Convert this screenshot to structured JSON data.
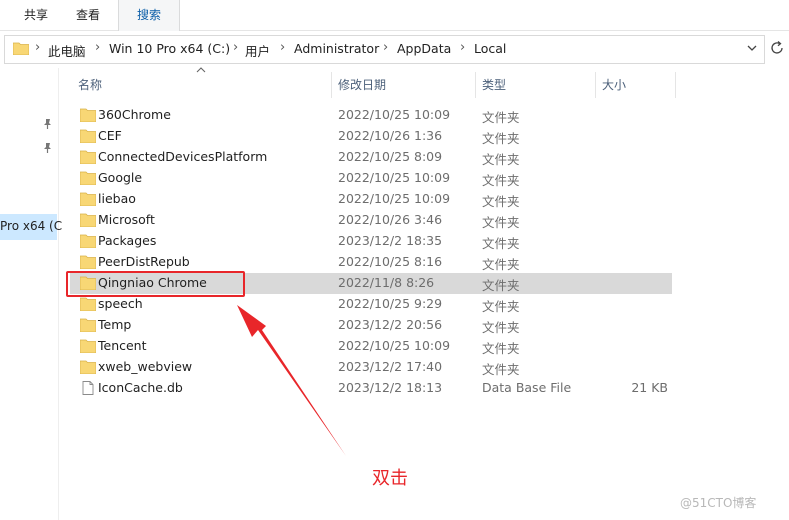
{
  "ribbon": {
    "tabs": [
      {
        "label": "共享"
      },
      {
        "label": "查看"
      },
      {
        "label": "搜索"
      }
    ]
  },
  "address": {
    "crumbs": [
      "此电脑",
      "Win 10 Pro x64 (C:)",
      "用户",
      "Administrator",
      "AppData",
      "Local"
    ],
    "separator": "›"
  },
  "nav": {
    "selected_label": "Pro x64 (C"
  },
  "columns": {
    "name": "名称",
    "date": "修改日期",
    "type": "类型",
    "size": "大小"
  },
  "files": [
    {
      "name": "360Chrome",
      "date": "2022/10/25 10:09",
      "type": "文件夹",
      "size": "",
      "icon": "folder-icon"
    },
    {
      "name": "CEF",
      "date": "2022/10/26 1:36",
      "type": "文件夹",
      "size": "",
      "icon": "folder-icon"
    },
    {
      "name": "ConnectedDevicesPlatform",
      "date": "2022/10/25 8:09",
      "type": "文件夹",
      "size": "",
      "icon": "folder-icon"
    },
    {
      "name": "Google",
      "date": "2022/10/25 10:09",
      "type": "文件夹",
      "size": "",
      "icon": "folder-icon"
    },
    {
      "name": "liebao",
      "date": "2022/10/25 10:09",
      "type": "文件夹",
      "size": "",
      "icon": "folder-icon"
    },
    {
      "name": "Microsoft",
      "date": "2022/10/26 3:46",
      "type": "文件夹",
      "size": "",
      "icon": "folder-icon"
    },
    {
      "name": "Packages",
      "date": "2023/12/2 18:35",
      "type": "文件夹",
      "size": "",
      "icon": "folder-icon"
    },
    {
      "name": "PeerDistRepub",
      "date": "2022/10/25 8:16",
      "type": "文件夹",
      "size": "",
      "icon": "folder-icon"
    },
    {
      "name": "Qingniao Chrome",
      "date": "2022/11/8 8:26",
      "type": "文件夹",
      "size": "",
      "icon": "folder-icon",
      "selected": true
    },
    {
      "name": "speech",
      "date": "2022/10/25 9:29",
      "type": "文件夹",
      "size": "",
      "icon": "folder-icon"
    },
    {
      "name": "Temp",
      "date": "2023/12/2 20:56",
      "type": "文件夹",
      "size": "",
      "icon": "folder-icon"
    },
    {
      "name": "Tencent",
      "date": "2022/10/25 10:09",
      "type": "文件夹",
      "size": "",
      "icon": "folder-icon"
    },
    {
      "name": "xweb_webview",
      "date": "2023/12/2 17:40",
      "type": "文件夹",
      "size": "",
      "icon": "folder-icon"
    },
    {
      "name": "IconCache.db",
      "date": "2023/12/2 18:13",
      "type": "Data Base File",
      "size": "21 KB",
      "icon": "file-icon"
    }
  ],
  "annotation": {
    "label": "双击",
    "color": "#e8262a"
  },
  "watermark": "@51CTO博客",
  "colors": {
    "folder": "#f8d775",
    "selected_row": "#d9d9d9",
    "nav_selected": "#cce8ff"
  }
}
